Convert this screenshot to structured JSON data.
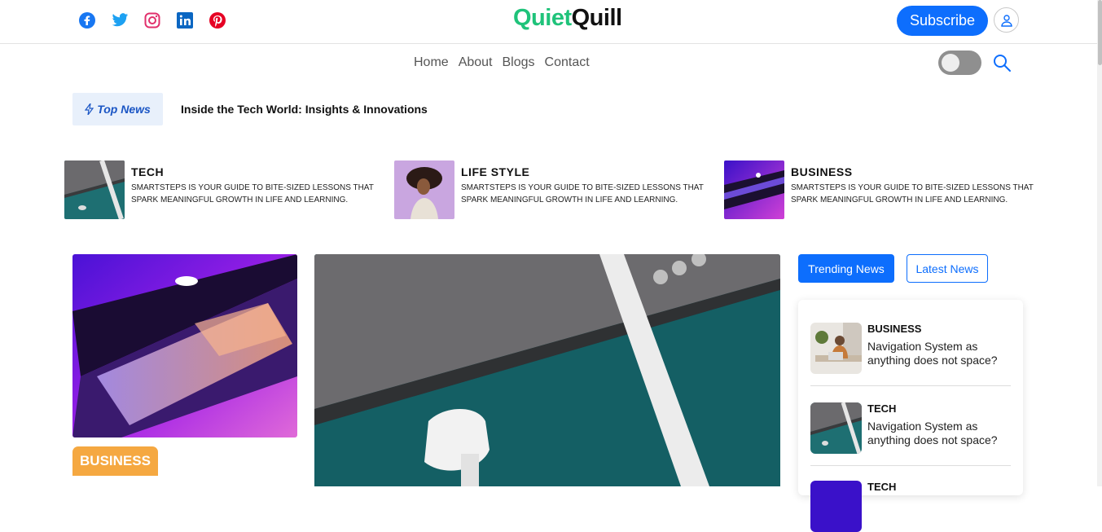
{
  "header": {
    "socials": [
      "facebook-icon",
      "twitter-icon",
      "instagram-icon",
      "linkedin-icon",
      "pinterest-icon"
    ],
    "logo_a": "Quiet",
    "logo_b": "Quill",
    "subscribe": "Subscribe",
    "colors": {
      "accent": "#0d6efd",
      "brand_green": "#1fc37a",
      "badge": "#f5a841"
    }
  },
  "nav": {
    "items": [
      "Home",
      "About",
      "Blogs",
      "Contact"
    ]
  },
  "ticker": {
    "label": "Top News",
    "headline": "Inside the Tech World: Insights & Innovations"
  },
  "categories": [
    {
      "title": "TECH",
      "desc": "SmartSteps is your guide to bite-sized lessons that spark meaningful growth in life and learning."
    },
    {
      "title": "LIFE STYLE",
      "desc": "SmartSteps is your guide to bite-sized lessons that spark meaningful growth in life and learning."
    },
    {
      "title": "BUSINESS",
      "desc": "SmartSteps is your guide to bite-sized lessons that spark meaningful growth in life and learning."
    }
  ],
  "featured": {
    "badge": "BUSINESS"
  },
  "sidebar": {
    "tabs": [
      "Trending News",
      "Latest News"
    ],
    "items": [
      {
        "category": "BUSINESS",
        "title": "Navigation System as anything does not space?"
      },
      {
        "category": "TECH",
        "title": "Navigation System as anything does not space?"
      },
      {
        "category": "TECH",
        "title": ""
      }
    ]
  }
}
